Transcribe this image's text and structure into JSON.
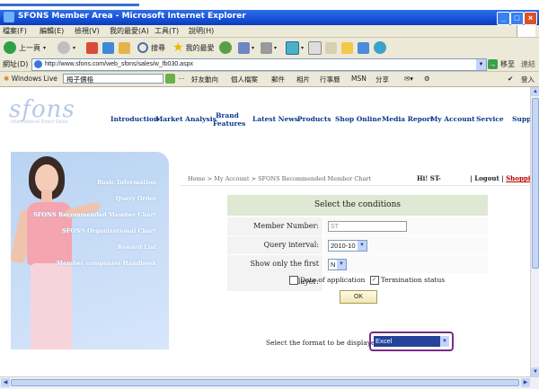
{
  "window": {
    "title": "SFONS Member Area - Microsoft Internet Explorer"
  },
  "menu": [
    "檔案(F)",
    "編輯(E)",
    "檢視(V)",
    "我的最愛(A)",
    "工具(T)",
    "說明(H)"
  ],
  "toolbar": {
    "back": "上一頁",
    "search": "搜尋",
    "favorites": "我的最愛"
  },
  "address": {
    "label": "網址(D)",
    "url": "http://www.sfons.com/web_sfons/sales/w_fb030.aspx",
    "go": "移至",
    "links": "連結"
  },
  "windows_live": {
    "brand": "Windows Live",
    "search_value": "梅子價格",
    "items": [
      "好友動向",
      "個人檔案",
      "郵件",
      "相片",
      "行事曆",
      "MSN",
      "分享"
    ],
    "signin": "登入"
  },
  "site": {
    "logo": "sfons",
    "logo_sub": "International Direct Sales",
    "nav": [
      "Introduction",
      "Market Analysis",
      "Brand Features",
      "Latest News",
      "Products",
      "Shop Online",
      "Media Report",
      "My Account",
      "Service",
      "Support"
    ],
    "left_menu": [
      "Basic Information",
      "Query Order",
      "SFONS Recommended Member Chart",
      "SFONS Organizational Chart",
      "Reward List",
      "Member companies Handbook"
    ]
  },
  "breadcrumb": {
    "home": "Home",
    "sep": ">",
    "account": "My Account",
    "page": "SFONS Recommended Member Chart"
  },
  "user": {
    "greeting": "Hi! ST-",
    "logout": "Logout",
    "cart": "Shopping Cart"
  },
  "form": {
    "heading": "Select the conditions",
    "member_number": {
      "label": "Member Number:",
      "value": "ST"
    },
    "query_interval": {
      "label": "Query interval:",
      "value": "2010-10"
    },
    "first_layer": {
      "label": "Show only the first layer:",
      "value": "N"
    },
    "date_of_application": {
      "label": "Date of application",
      "checked": false
    },
    "termination_status": {
      "label": "Termination status",
      "checked": true
    },
    "ok": "OK",
    "format_label": "Select the format to be displayed",
    "format_value": "Excel"
  },
  "colors": {
    "titlebar": "#1650d6",
    "nav": "#0a3a8f",
    "highlight_ring": "#7b2c8a",
    "selected": "#23449a"
  }
}
